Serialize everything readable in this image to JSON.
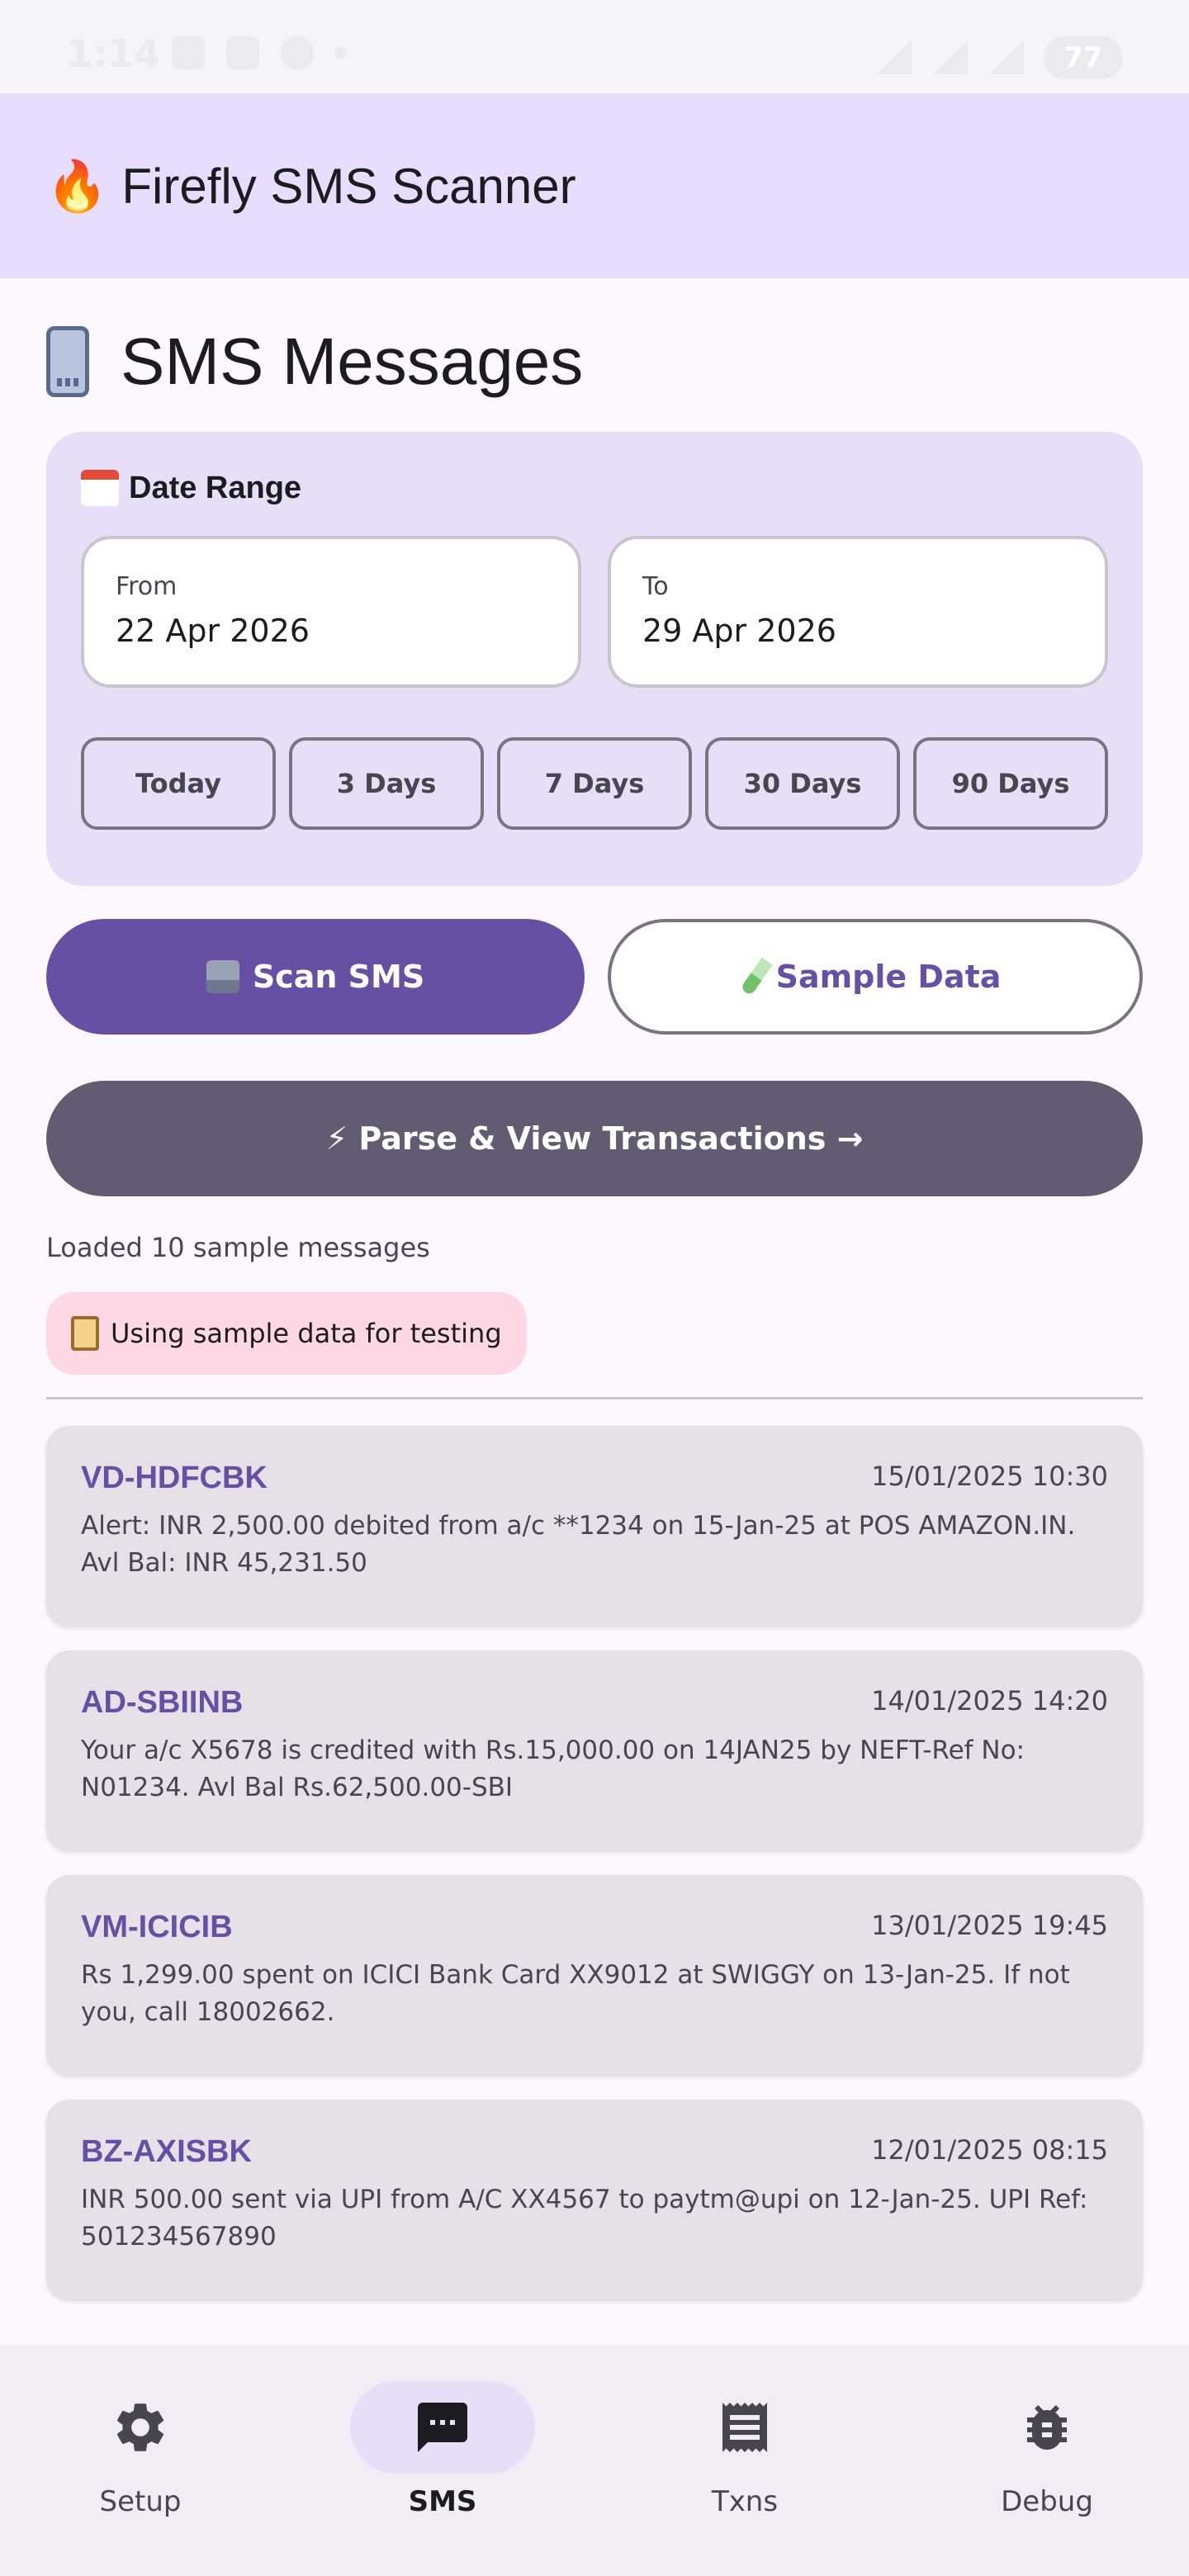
{
  "status_bar": {
    "time": "1:14",
    "battery": "77"
  },
  "app_bar": {
    "title": "🔥 Firefly SMS Scanner"
  },
  "page": {
    "title": "SMS Messages"
  },
  "date_range": {
    "heading": "Date Range",
    "from_label": "From",
    "from_value": "22 Apr 2026",
    "to_label": "To",
    "to_value": "29 Apr 2026",
    "presets": [
      "Today",
      "3 Days",
      "7 Days",
      "30 Days",
      "90 Days"
    ]
  },
  "actions": {
    "scan_label": "Scan SMS",
    "sample_label": "Sample Data",
    "parse_label": "⚡ Parse & View Transactions →"
  },
  "status": {
    "loaded_text": "Loaded 10 sample messages",
    "badge_text": "Using sample data for testing"
  },
  "messages": [
    {
      "sender": "VD-HDFCBK",
      "time": "15/01/2025 10:30",
      "body": "Alert: INR 2,500.00 debited from a/c **1234 on 15-Jan-25 at POS AMAZON.IN. Avl Bal: INR 45,231.50"
    },
    {
      "sender": "AD-SBIINB",
      "time": "14/01/2025 14:20",
      "body": "Your a/c X5678 is credited with Rs.15,000.00 on 14JAN25 by NEFT-Ref No: N01234. Avl Bal Rs.62,500.00-SBI"
    },
    {
      "sender": "VM-ICICIB",
      "time": "13/01/2025 19:45",
      "body": "Rs 1,299.00 spent on ICICI Bank Card XX9012 at SWIGGY on 13-Jan-25. If not you, call 18002662."
    },
    {
      "sender": "BZ-AXISBK",
      "time": "12/01/2025 08:15",
      "body": "INR 500.00 sent via UPI from A/C XX4567 to paytm@upi on 12-Jan-25. UPI Ref: 501234567890"
    }
  ],
  "nav": {
    "items": [
      {
        "label": "Setup",
        "icon": "gear-icon"
      },
      {
        "label": "SMS",
        "icon": "message-icon",
        "active": true
      },
      {
        "label": "Txns",
        "icon": "receipt-icon"
      },
      {
        "label": "Debug",
        "icon": "bug-icon"
      }
    ]
  },
  "colors": {
    "primary": "#6750a4",
    "app_bar": "#e9ddff",
    "card": "#e6dff7",
    "parse_button": "#625b71",
    "badge": "#ffd8e4"
  }
}
